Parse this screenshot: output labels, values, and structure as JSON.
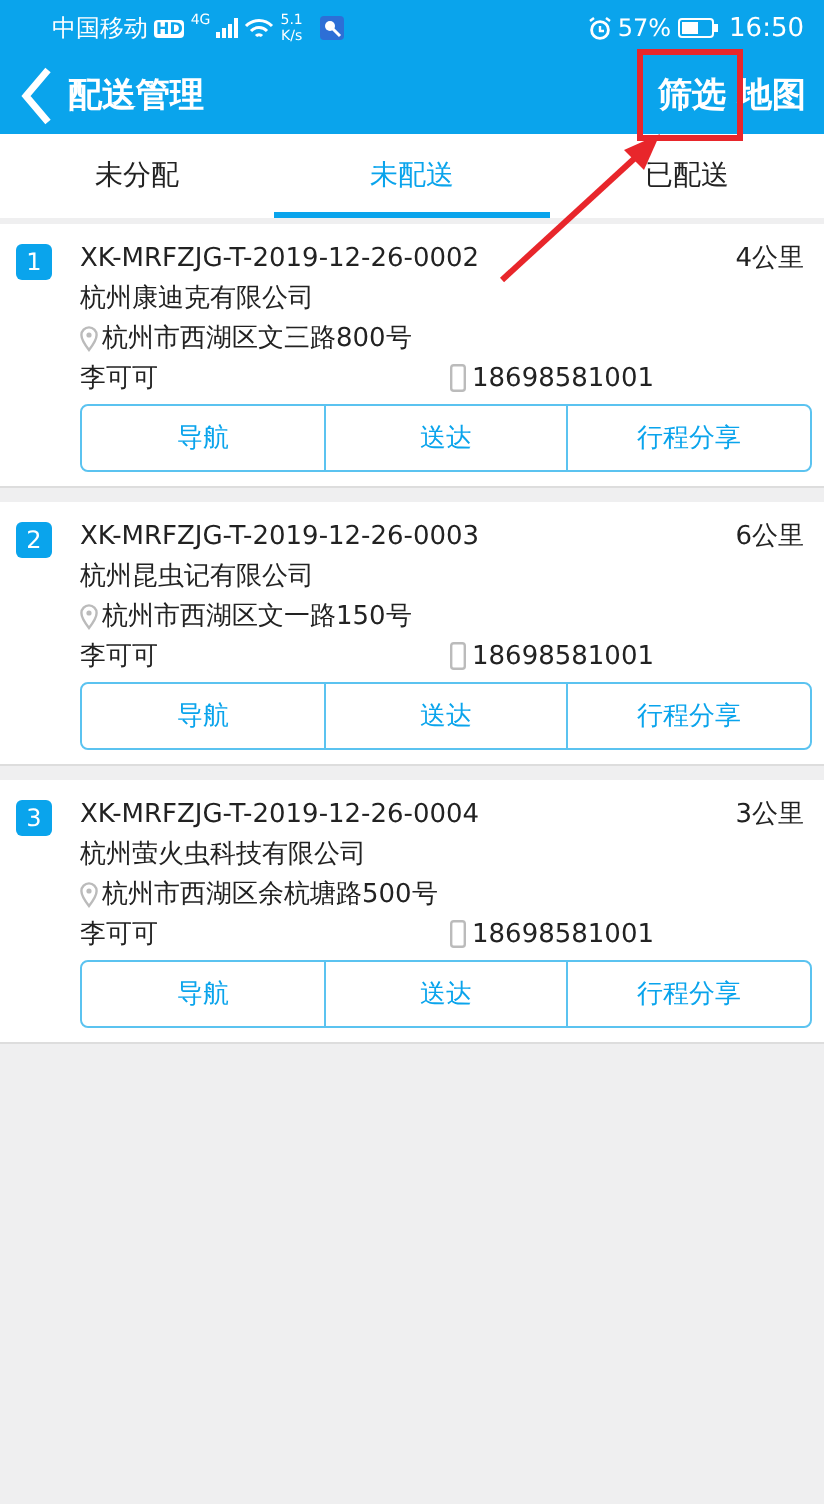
{
  "status_bar": {
    "carrier": "中国移动",
    "hd": "HD",
    "network": "4G",
    "speed_value": "5.1",
    "speed_unit": "K/s",
    "battery": "57%",
    "time": "16:50"
  },
  "header": {
    "back": true,
    "title": "配送管理",
    "actions": [
      {
        "label": "筛选",
        "highlighted": true
      },
      {
        "label": "地图",
        "highlighted": false
      }
    ]
  },
  "tabs": [
    {
      "label": "未分配",
      "selected": false
    },
    {
      "label": "未配送",
      "selected": true
    },
    {
      "label": "已配送",
      "selected": false
    }
  ],
  "orders": [
    {
      "index": "1",
      "code": "XK-MRFZJG-T-2019-12-26-0002",
      "distance": "4公里",
      "company": "杭州康迪克有限公司",
      "address": "杭州市西湖区文三路800号",
      "contact": "李可可",
      "phone": "18698581001",
      "buttons": [
        "导航",
        "送达",
        "行程分享"
      ]
    },
    {
      "index": "2",
      "code": "XK-MRFZJG-T-2019-12-26-0003",
      "distance": "6公里",
      "company": "杭州昆虫记有限公司",
      "address": "杭州市西湖区文一路150号",
      "contact": "李可可",
      "phone": "18698581001",
      "buttons": [
        "导航",
        "送达",
        "行程分享"
      ]
    },
    {
      "index": "3",
      "code": "XK-MRFZJG-T-2019-12-26-0004",
      "distance": "3公里",
      "company": "杭州萤火虫科技有限公司",
      "address": "杭州市西湖区余杭塘路500号",
      "contact": "李可可",
      "phone": "18698581001",
      "buttons": [
        "导航",
        "送达",
        "行程分享"
      ]
    }
  ]
}
